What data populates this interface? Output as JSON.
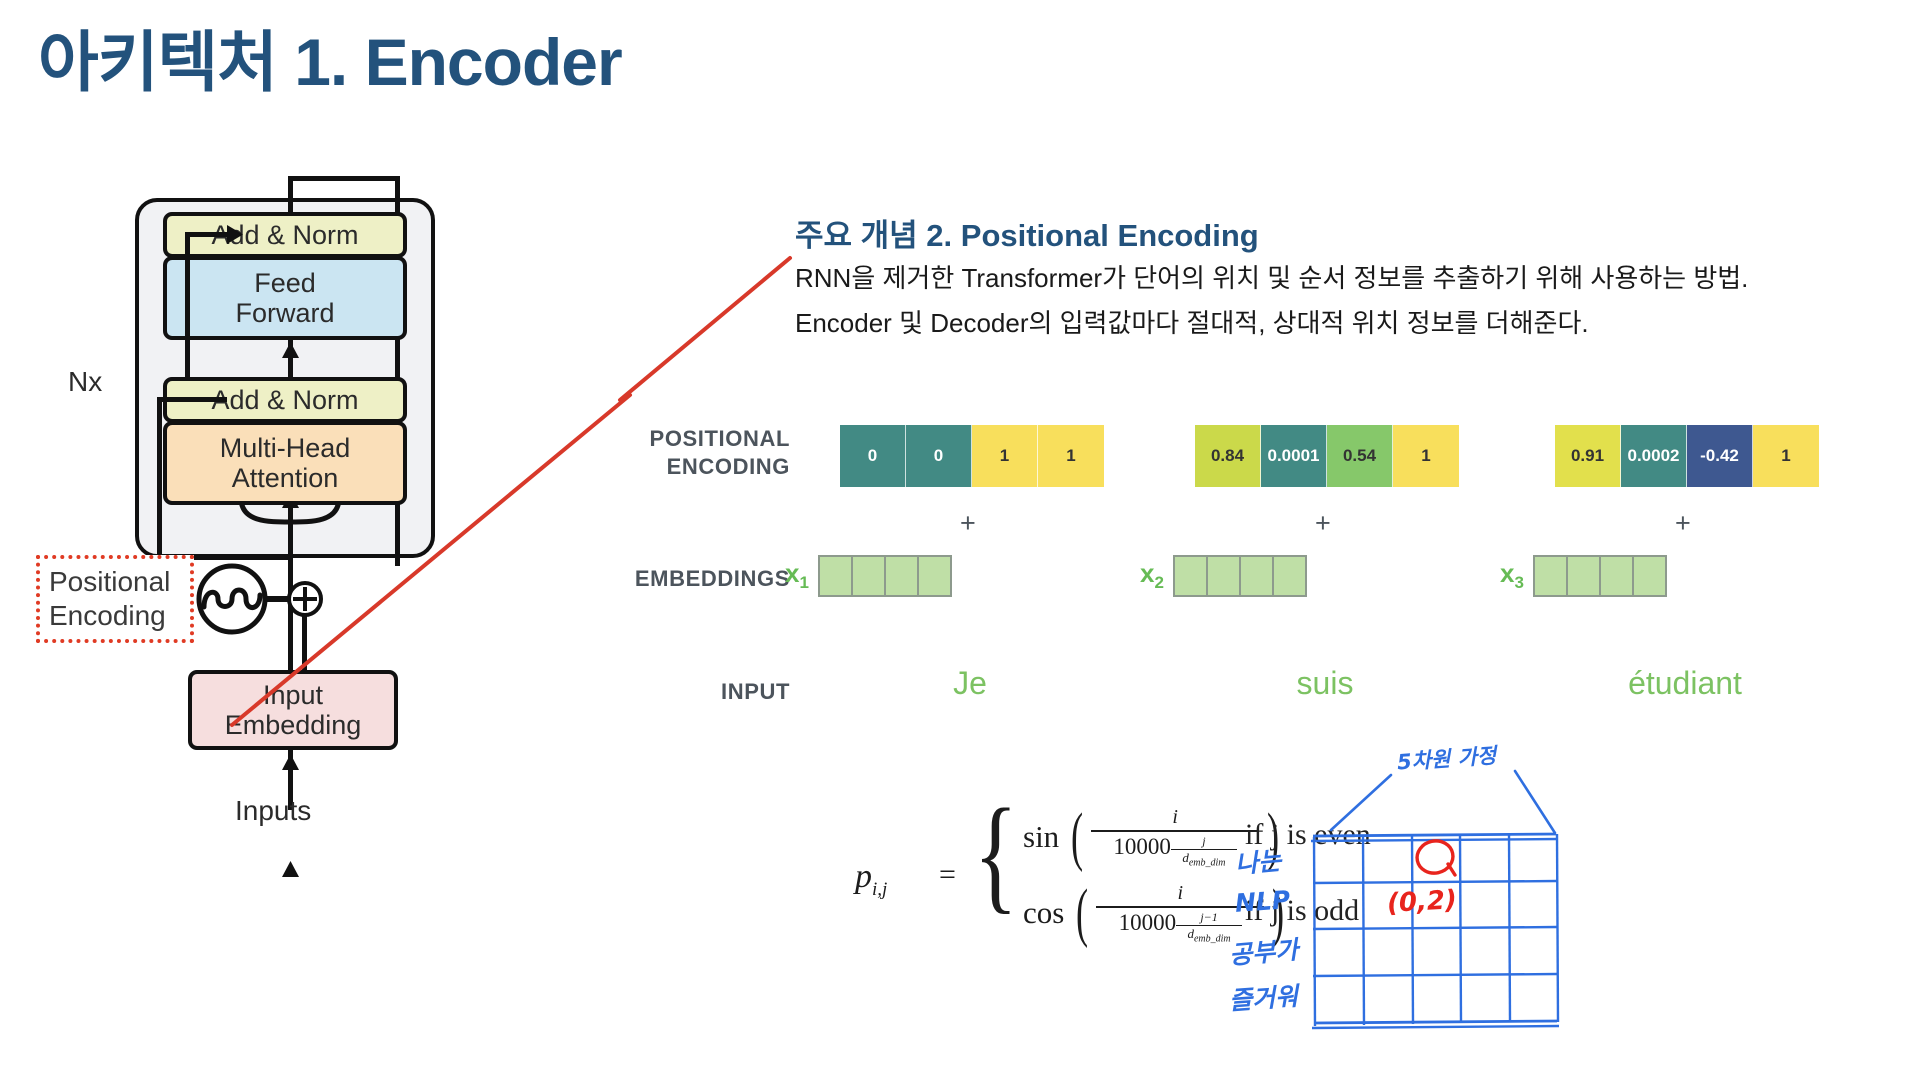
{
  "slide": {
    "title": "아키텍처 1. Encoder",
    "title_color": "#23527C"
  },
  "encoder_diagram": {
    "nx_label": "Nx",
    "boxes": {
      "add_norm_top": "Add & Norm",
      "feed_forward": "Feed\nForward",
      "feed_forward_line1": "Feed",
      "feed_forward_line2": "Forward",
      "add_norm_bottom": "Add & Norm",
      "multi_head_line1": "Multi-Head",
      "multi_head_line2": "Attention",
      "input_embedding_line1": "Input",
      "input_embedding_line2": "Embedding"
    },
    "callout": {
      "line1": "Positional",
      "line2": "Encoding",
      "border_color": "#e03b24"
    },
    "inputs_label": "Inputs",
    "plus_symbol": "⊕",
    "colors": {
      "add_norm": "#eef0c6",
      "feed_forward": "#cbe5f2",
      "multi_head": "#fadfb9",
      "input_embedding": "#f6dede",
      "plate": "#f1f2f4"
    }
  },
  "concept": {
    "heading": "주요 개념 2.  Positional Encoding",
    "line1": "RNN을 제거한 Transformer가 단어의 위치 및 순서 정보를 추출하기 위해 사용하는 방법.",
    "line2": "Encoder 및 Decoder의 입력값마다 절대적, 상대적 위치 정보를 더해준다."
  },
  "matrix": {
    "row_labels": {
      "positional_encoding_line1": "POSITIONAL",
      "positional_encoding_line2": "ENCODING",
      "embeddings": "EMBEDDINGS",
      "input": "INPUT"
    },
    "plus_symbol": "+",
    "groups": [
      {
        "pe_values": [
          "0",
          "0",
          "1",
          "1"
        ],
        "pe_colors": [
          "#428A84",
          "#428A84",
          "#F8DF5C",
          "#F8DF5C"
        ],
        "pe_text_colors": [
          "#ffffff",
          "#ffffff",
          "#333333",
          "#333333"
        ],
        "embedding_label": "x",
        "embedding_sub": "1",
        "embedding_cells": 4,
        "input_word": "Je"
      },
      {
        "pe_values": [
          "0.84",
          "0.0001",
          "0.54",
          "1"
        ],
        "pe_colors": [
          "#CBD94A",
          "#428A84",
          "#86C86A",
          "#F8DF5C"
        ],
        "pe_text_colors": [
          "#333333",
          "#ffffff",
          "#333333",
          "#333333"
        ],
        "embedding_label": "x",
        "embedding_sub": "2",
        "embedding_cells": 4,
        "input_word": "suis"
      },
      {
        "pe_values": [
          "0.91",
          "0.0002",
          "-0.42",
          "1"
        ],
        "pe_colors": [
          "#E2E04C",
          "#428A84",
          "#3E5890",
          "#F8DF5C"
        ],
        "pe_text_colors": [
          "#333333",
          "#ffffff",
          "#ffffff",
          "#333333"
        ],
        "embedding_label": "x",
        "embedding_sub": "3",
        "embedding_cells": 4,
        "input_word": "étudiant"
      }
    ]
  },
  "formula": {
    "lhs": "p",
    "lhs_sub": "i,j",
    "equals": "=",
    "even": {
      "function": "sin",
      "numerator": "i",
      "denominator_base": "10000",
      "exponent_numerator": "j",
      "exponent_denominator": "d",
      "exponent_denominator_sub": "emb_dim",
      "condition": "if j is even"
    },
    "odd": {
      "function": "cos",
      "numerator": "i",
      "denominator_base": "10000",
      "exponent_numerator": "j−1",
      "exponent_denominator": "d",
      "exponent_denominator_sub": "emb_dim",
      "condition": "if j is odd"
    }
  },
  "handwriting": {
    "top_label": "5차원 가정",
    "row_labels": [
      "나는",
      "NLP",
      "공부가",
      "즐거워"
    ],
    "red_circle_mark": "O",
    "red_coordinate": "(0,2)",
    "ink_color": "#2f6fe0",
    "red_color": "#e8241d",
    "grid_columns": 5,
    "grid_rows": 4
  }
}
